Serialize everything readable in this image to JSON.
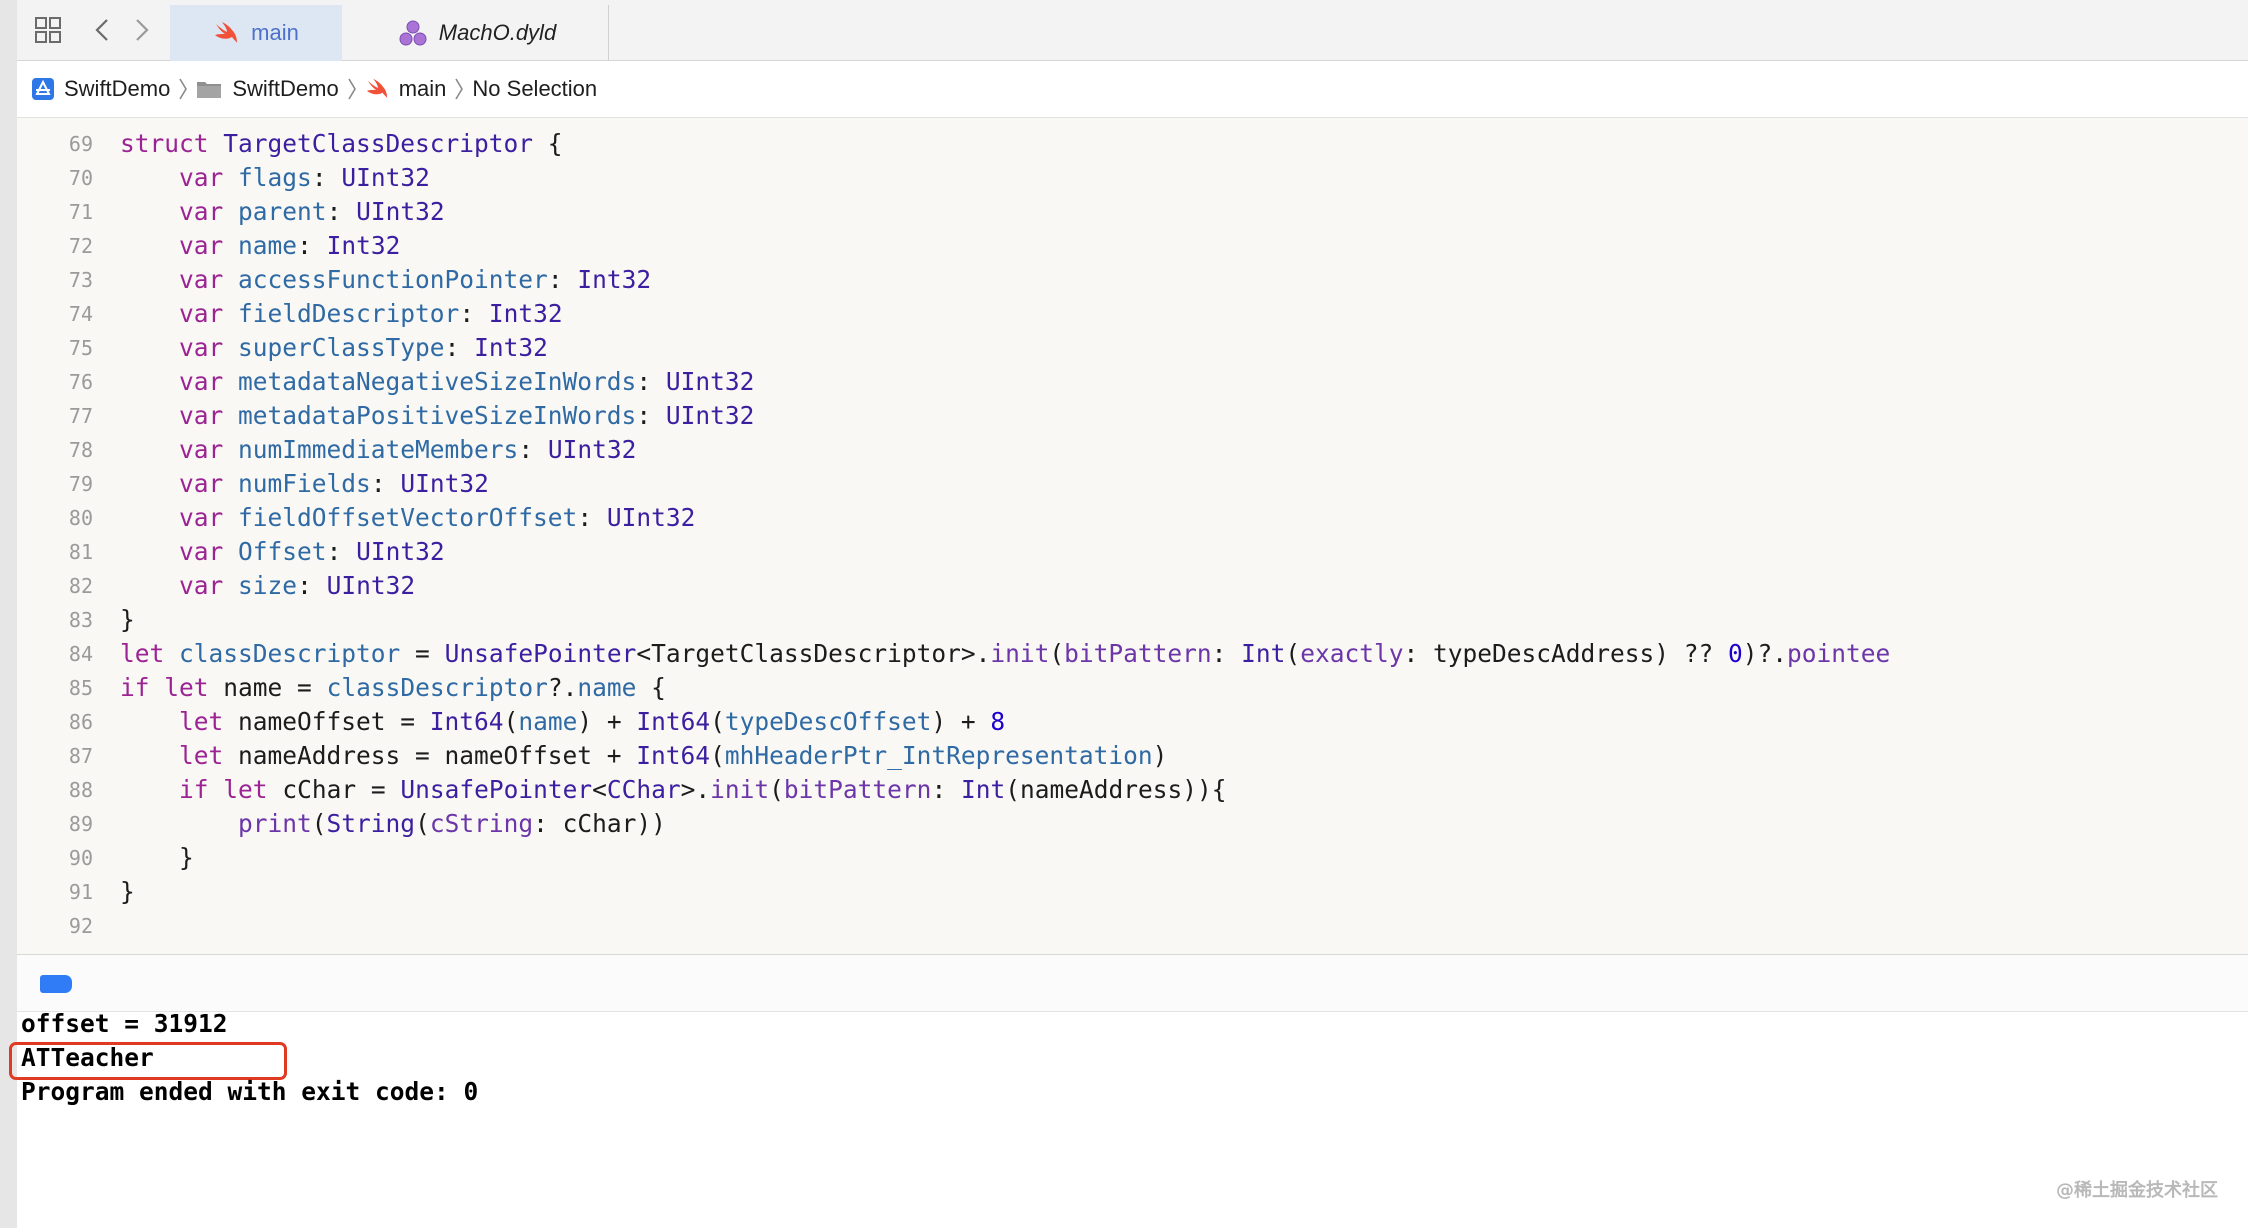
{
  "tabs": [
    {
      "label": "main",
      "icon": "swift-file-icon",
      "active": true
    },
    {
      "label": "MachO.dyld",
      "icon": "package-icon",
      "active": false
    }
  ],
  "breadcrumb": [
    {
      "label": "SwiftDemo",
      "icon": "xcode-project-icon"
    },
    {
      "label": "SwiftDemo",
      "icon": "folder-icon"
    },
    {
      "label": "main",
      "icon": "swift-file-icon"
    },
    {
      "label": "No Selection",
      "icon": ""
    }
  ],
  "editor": {
    "lines": [
      {
        "n": "69",
        "tokens": [
          [
            "kw",
            "struct"
          ],
          [
            "p",
            " "
          ],
          [
            "ty",
            "TargetClassDescriptor"
          ],
          [
            "p",
            " {"
          ]
        ]
      },
      {
        "n": "70",
        "tokens": [
          [
            "p",
            "    "
          ],
          [
            "kw",
            "var"
          ],
          [
            "p",
            " "
          ],
          [
            "id",
            "flags"
          ],
          [
            "p",
            ": "
          ],
          [
            "ty",
            "UInt32"
          ]
        ]
      },
      {
        "n": "71",
        "tokens": [
          [
            "p",
            "    "
          ],
          [
            "kw",
            "var"
          ],
          [
            "p",
            " "
          ],
          [
            "id",
            "parent"
          ],
          [
            "p",
            ": "
          ],
          [
            "ty",
            "UInt32"
          ]
        ]
      },
      {
        "n": "72",
        "tokens": [
          [
            "p",
            "    "
          ],
          [
            "kw",
            "var"
          ],
          [
            "p",
            " "
          ],
          [
            "id",
            "name"
          ],
          [
            "p",
            ": "
          ],
          [
            "ty",
            "Int32"
          ]
        ]
      },
      {
        "n": "73",
        "tokens": [
          [
            "p",
            "    "
          ],
          [
            "kw",
            "var"
          ],
          [
            "p",
            " "
          ],
          [
            "id",
            "accessFunctionPointer"
          ],
          [
            "p",
            ": "
          ],
          [
            "ty",
            "Int32"
          ]
        ]
      },
      {
        "n": "74",
        "tokens": [
          [
            "p",
            "    "
          ],
          [
            "kw",
            "var"
          ],
          [
            "p",
            " "
          ],
          [
            "id",
            "fieldDescriptor"
          ],
          [
            "p",
            ": "
          ],
          [
            "ty",
            "Int32"
          ]
        ]
      },
      {
        "n": "75",
        "tokens": [
          [
            "p",
            "    "
          ],
          [
            "kw",
            "var"
          ],
          [
            "p",
            " "
          ],
          [
            "id",
            "superClassType"
          ],
          [
            "p",
            ": "
          ],
          [
            "ty",
            "Int32"
          ]
        ]
      },
      {
        "n": "76",
        "tokens": [
          [
            "p",
            "    "
          ],
          [
            "kw",
            "var"
          ],
          [
            "p",
            " "
          ],
          [
            "id",
            "metadataNegativeSizeInWords"
          ],
          [
            "p",
            ": "
          ],
          [
            "ty",
            "UInt32"
          ]
        ]
      },
      {
        "n": "77",
        "tokens": [
          [
            "p",
            "    "
          ],
          [
            "kw",
            "var"
          ],
          [
            "p",
            " "
          ],
          [
            "id",
            "metadataPositiveSizeInWords"
          ],
          [
            "p",
            ": "
          ],
          [
            "ty",
            "UInt32"
          ]
        ]
      },
      {
        "n": "78",
        "tokens": [
          [
            "p",
            "    "
          ],
          [
            "kw",
            "var"
          ],
          [
            "p",
            " "
          ],
          [
            "id",
            "numImmediateMembers"
          ],
          [
            "p",
            ": "
          ],
          [
            "ty",
            "UInt32"
          ]
        ]
      },
      {
        "n": "79",
        "tokens": [
          [
            "p",
            "    "
          ],
          [
            "kw",
            "var"
          ],
          [
            "p",
            " "
          ],
          [
            "id",
            "numFields"
          ],
          [
            "p",
            ": "
          ],
          [
            "ty",
            "UInt32"
          ]
        ]
      },
      {
        "n": "80",
        "tokens": [
          [
            "p",
            "    "
          ],
          [
            "kw",
            "var"
          ],
          [
            "p",
            " "
          ],
          [
            "id",
            "fieldOffsetVectorOffset"
          ],
          [
            "p",
            ": "
          ],
          [
            "ty",
            "UInt32"
          ]
        ]
      },
      {
        "n": "81",
        "tokens": [
          [
            "p",
            "    "
          ],
          [
            "kw",
            "var"
          ],
          [
            "p",
            " "
          ],
          [
            "id",
            "Offset"
          ],
          [
            "p",
            ": "
          ],
          [
            "ty",
            "UInt32"
          ]
        ]
      },
      {
        "n": "82",
        "tokens": [
          [
            "p",
            "    "
          ],
          [
            "kw",
            "var"
          ],
          [
            "p",
            " "
          ],
          [
            "id",
            "size"
          ],
          [
            "p",
            ": "
          ],
          [
            "ty",
            "UInt32"
          ]
        ]
      },
      {
        "n": "83",
        "tokens": [
          [
            "p",
            "}"
          ]
        ]
      },
      {
        "n": "84",
        "tokens": [
          [
            "kw",
            "let"
          ],
          [
            "p",
            " "
          ],
          [
            "id",
            "classDescriptor"
          ],
          [
            "p",
            " = "
          ],
          [
            "ty",
            "UnsafePointer"
          ],
          [
            "p",
            "<TargetClassDescriptor>."
          ],
          [
            "fn",
            "init"
          ],
          [
            "p",
            "("
          ],
          [
            "fn",
            "bitPattern"
          ],
          [
            "p",
            ": "
          ],
          [
            "ty",
            "Int"
          ],
          [
            "p",
            "("
          ],
          [
            "fn",
            "exactly"
          ],
          [
            "p",
            ": typeDescAddress) ?? "
          ],
          [
            "num",
            "0"
          ],
          [
            "p",
            ")?."
          ],
          [
            "fn",
            "pointee"
          ]
        ]
      },
      {
        "n": "85",
        "tokens": [
          [
            "kw",
            "if"
          ],
          [
            "p",
            " "
          ],
          [
            "kw",
            "let"
          ],
          [
            "p",
            " name = "
          ],
          [
            "id",
            "classDescriptor"
          ],
          [
            "p",
            "?."
          ],
          [
            "id",
            "name"
          ],
          [
            "p",
            " {"
          ]
        ]
      },
      {
        "n": "86",
        "tokens": [
          [
            "p",
            "    "
          ],
          [
            "kw",
            "let"
          ],
          [
            "p",
            " nameOffset = "
          ],
          [
            "ty",
            "Int64"
          ],
          [
            "p",
            "("
          ],
          [
            "id",
            "name"
          ],
          [
            "p",
            ") + "
          ],
          [
            "ty",
            "Int64"
          ],
          [
            "p",
            "("
          ],
          [
            "id",
            "typeDescOffset"
          ],
          [
            "p",
            ") + "
          ],
          [
            "num",
            "8"
          ]
        ]
      },
      {
        "n": "87",
        "tokens": [
          [
            "p",
            "    "
          ],
          [
            "kw",
            "let"
          ],
          [
            "p",
            " nameAddress = nameOffset + "
          ],
          [
            "ty",
            "Int64"
          ],
          [
            "p",
            "("
          ],
          [
            "id",
            "mhHeaderPtr_IntRepresentation"
          ],
          [
            "p",
            ")"
          ]
        ]
      },
      {
        "n": "88",
        "tokens": [
          [
            "p",
            "    "
          ],
          [
            "kw",
            "if"
          ],
          [
            "p",
            " "
          ],
          [
            "kw",
            "let"
          ],
          [
            "p",
            " cChar = "
          ],
          [
            "ty",
            "UnsafePointer"
          ],
          [
            "p",
            "<"
          ],
          [
            "ty",
            "CChar"
          ],
          [
            "p",
            ">."
          ],
          [
            "fn",
            "init"
          ],
          [
            "p",
            "("
          ],
          [
            "fn",
            "bitPattern"
          ],
          [
            "p",
            ": "
          ],
          [
            "ty",
            "Int"
          ],
          [
            "p",
            "(nameAddress)){"
          ]
        ]
      },
      {
        "n": "89",
        "tokens": [
          [
            "p",
            "        "
          ],
          [
            "fn",
            "print"
          ],
          [
            "p",
            "("
          ],
          [
            "ty",
            "String"
          ],
          [
            "p",
            "("
          ],
          [
            "fn",
            "cString"
          ],
          [
            "p",
            ": cChar))"
          ]
        ]
      },
      {
        "n": "90",
        "tokens": [
          [
            "p",
            "    }"
          ]
        ]
      },
      {
        "n": "91",
        "tokens": [
          [
            "p",
            "}"
          ]
        ]
      },
      {
        "n": "92",
        "tokens": []
      }
    ]
  },
  "console": {
    "lines": [
      "offset = 31912",
      "ATTeacher",
      "Program ended with exit code: 0"
    ]
  },
  "watermark": "@稀土掘金技术社区"
}
